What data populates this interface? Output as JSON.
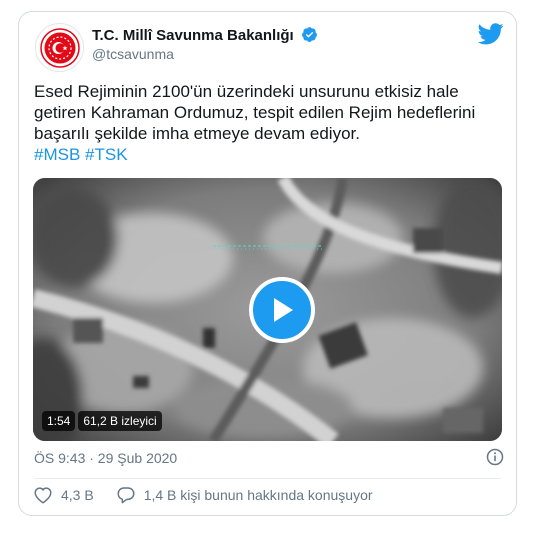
{
  "account": {
    "name": "T.C. Millî Savunma Bakanlığı",
    "handle": "@tcsavunma"
  },
  "tweet": {
    "text": "Esed Rejiminin 2100'ün üzerindeki unsurunu etkisiz hale getiren Kahraman Ordumuz, tespit edilen Rejim hedeflerini başarılı şekilde imha etmeye devam ediyor.",
    "hashtags": "#MSB #TSK"
  },
  "video": {
    "duration": "1:54",
    "views": "61,2 B izleyici"
  },
  "meta": {
    "timestamp": "ÖS 9:43 · 29 Şub 2020"
  },
  "actions": {
    "likes": "4,3 B",
    "conversation": "1,4 B kişi bunun hakkında konuşuyor"
  },
  "colors": {
    "accent": "#1d9bf0",
    "muted": "#657786",
    "logo_red": "#e30a17"
  },
  "icons": [
    "verified-badge-icon",
    "twitter-bird-icon",
    "play-icon",
    "info-icon",
    "heart-icon",
    "comment-icon"
  ]
}
